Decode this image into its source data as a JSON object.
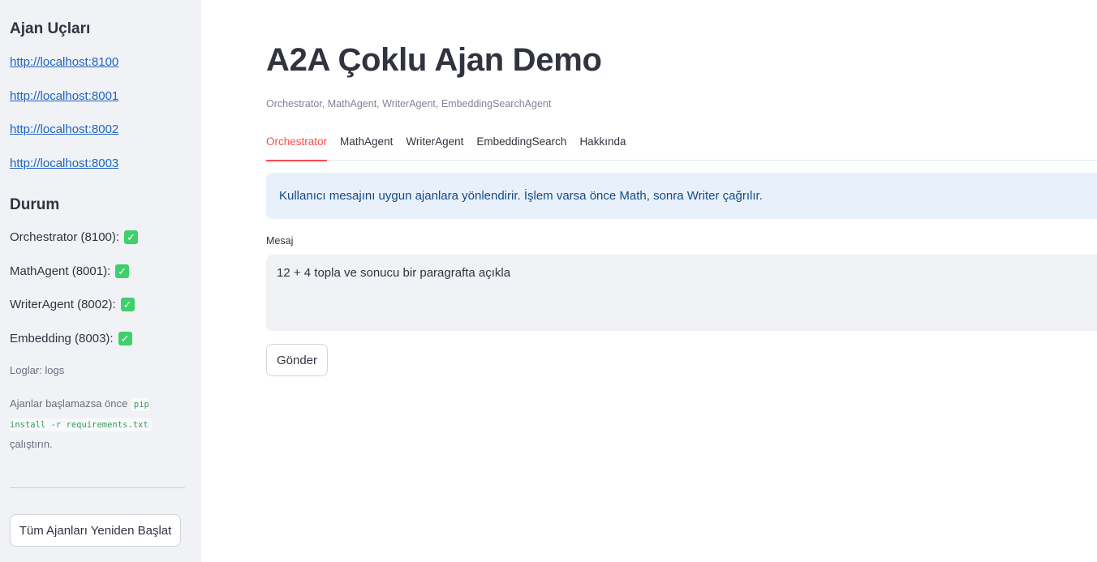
{
  "sidebar": {
    "endpoints_heading": "Ajan Uçları",
    "endpoints": [
      "http://localhost:8100",
      "http://localhost:8001",
      "http://localhost:8002",
      "http://localhost:8003"
    ],
    "status_heading": "Durum",
    "statuses": [
      {
        "label": "Orchestrator (8100):",
        "icon": "check-icon"
      },
      {
        "label": "MathAgent (8001):",
        "icon": "check-icon"
      },
      {
        "label": "WriterAgent (8002):",
        "icon": "check-icon"
      },
      {
        "label": "Embedding (8003):",
        "icon": "check-icon"
      }
    ],
    "logs_caption": "Loglar: logs",
    "note_prefix": "Ajanlar başlamazsa önce",
    "note_code": "pip install -r requirements.txt",
    "note_suffix": "çalıştırın.",
    "restart_button": "Tüm Ajanları Yeniden Başlat"
  },
  "main": {
    "title": "A2A Çoklu Ajan Demo",
    "subtitle": "Orchestrator, MathAgent, WriterAgent, EmbeddingSearchAgent",
    "tabs": [
      {
        "label": "Orchestrator",
        "active": true
      },
      {
        "label": "MathAgent",
        "active": false
      },
      {
        "label": "WriterAgent",
        "active": false
      },
      {
        "label": "EmbeddingSearch",
        "active": false
      },
      {
        "label": "Hakkında",
        "active": false
      }
    ],
    "info_text": "Kullanıcı mesajını uygun ajanlara yönlendirir. İşlem varsa önce Math, sonra Writer çağrılır.",
    "message_label": "Mesaj",
    "message_value": "12 + 4 topla ve sonucu bir paragrafta açıkla",
    "send_button": "Gönder"
  },
  "colors": {
    "accent": "#ff4b4b",
    "link": "#1f64c0",
    "info_bg": "#e8f0fb",
    "info_text": "#164a86",
    "check": "#3fcf6b"
  }
}
